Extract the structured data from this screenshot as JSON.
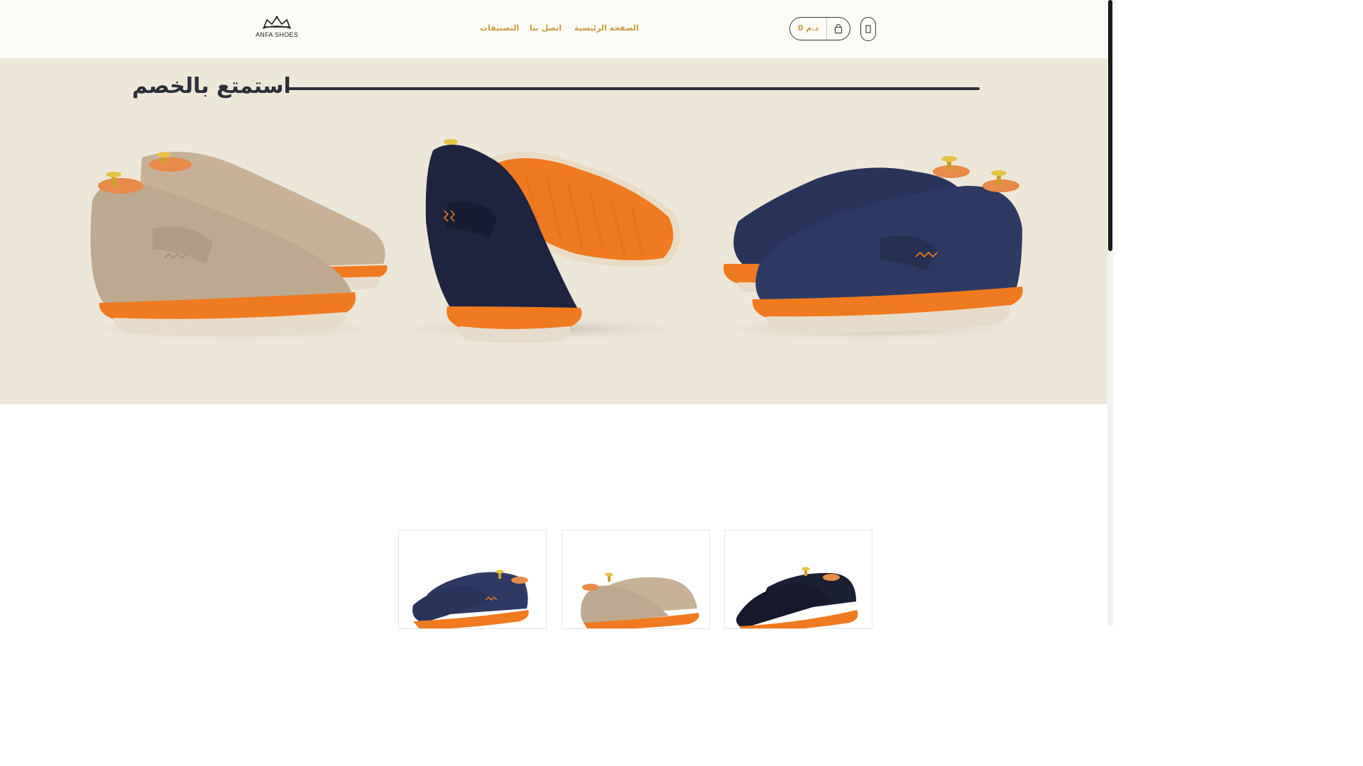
{
  "header": {
    "logo_text": "ANFA SHOES",
    "nav": {
      "home": "الصفحة الرئيسية",
      "contact": "اتصل بنا",
      "categories": "التصنيفات"
    },
    "cart_price": "0 د.م",
    "icons": {
      "cart": "cart-icon",
      "menu": "menu-icon",
      "logo": "crown-icon"
    }
  },
  "banner": {
    "headline": "استمتع بالخصم"
  },
  "colors": {
    "accent": "#c79a3c",
    "banner_bg": "#ede7d9",
    "dark": "#2b2f3a",
    "sole_orange": "#f07a1f"
  }
}
